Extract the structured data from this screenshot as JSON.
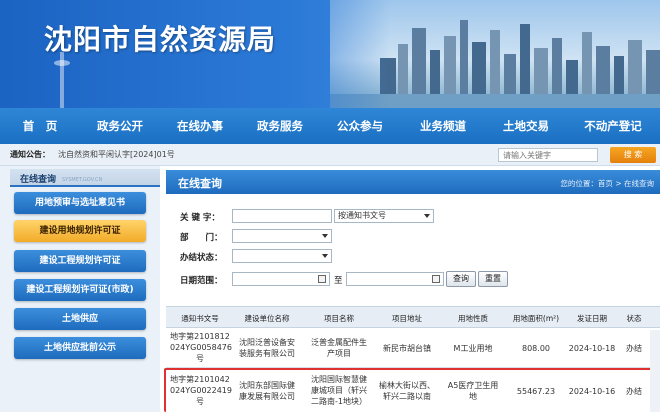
{
  "site": {
    "title": "沈阳市自然资源局"
  },
  "nav": {
    "items": [
      "首　页",
      "政务公开",
      "在线办事",
      "政务服务",
      "公众参与",
      "业务频道",
      "土地交易",
      "不动产登记"
    ]
  },
  "notice": {
    "label": "通知公告：",
    "text": "沈自然资和平闲认字[2024]01号",
    "search_placeholder": "请输入关键字",
    "search_button": "搜 索"
  },
  "sidebar": {
    "title": "在线查询",
    "title_en": "SYSMET.GOV.CN",
    "items": [
      {
        "label": "用地预审与选址意见书",
        "active": false
      },
      {
        "label": "建设用地规划许可证",
        "active": true
      },
      {
        "label": "建设工程规划许可证",
        "active": false
      },
      {
        "label": "建设工程规划许可证(市政)",
        "active": false
      },
      {
        "label": "土地供应",
        "active": false
      },
      {
        "label": "土地供应批前公示",
        "active": false
      }
    ]
  },
  "main": {
    "title": "在线查询",
    "breadcrumb": "您的位置：首页 > 在线查询"
  },
  "form": {
    "keyword_label": "关 键 字：",
    "keyword_value": "",
    "keyword_type_selected": "按通知书文号",
    "department_label": "部　　门：",
    "department_selected": "",
    "status_label": "办结状态：",
    "status_selected": "",
    "date_label": "日期范围：",
    "date_from": "",
    "date_to_label": "至",
    "date_to": "",
    "query_button": "查询",
    "reset_button": "重置"
  },
  "table": {
    "headers": [
      "通知书文号",
      "建设单位名称",
      "项目名称",
      "项目地址",
      "用地性质",
      "用地面积(m²)",
      "发证日期",
      "状态"
    ],
    "rows": [
      {
        "doc_no": [
          "地字第2101812",
          "024YG0058476",
          "号"
        ],
        "company": [
          "沈阳泛普设备安",
          "装服务有限公司"
        ],
        "project": [
          "泛普金属配件生",
          "产项目"
        ],
        "address": [
          "新民市胡台镇"
        ],
        "land_use": [
          "M工业用地"
        ],
        "area": "808.00",
        "date": "2024-10-18",
        "status": "办结"
      },
      {
        "doc_no": [
          "地字第2101042",
          "024YG0022419",
          "号"
        ],
        "company": [
          "沈阳东部国际健",
          "康发展有限公司"
        ],
        "project": [
          "沈阳国际智慧健",
          "康城项目（轩兴",
          "二路南-1地块）"
        ],
        "address": [
          "榆林大街以西、",
          "轩兴二路以南"
        ],
        "land_use": [
          "A5医疗卫生用",
          "地"
        ],
        "area": "55467.23",
        "date": "2024-10-16",
        "status": "办结"
      }
    ]
  },
  "colors": {
    "nav_blue": "#1a6fc2",
    "active_tab": "#f2ab28",
    "highlight_border": "#e03131"
  }
}
